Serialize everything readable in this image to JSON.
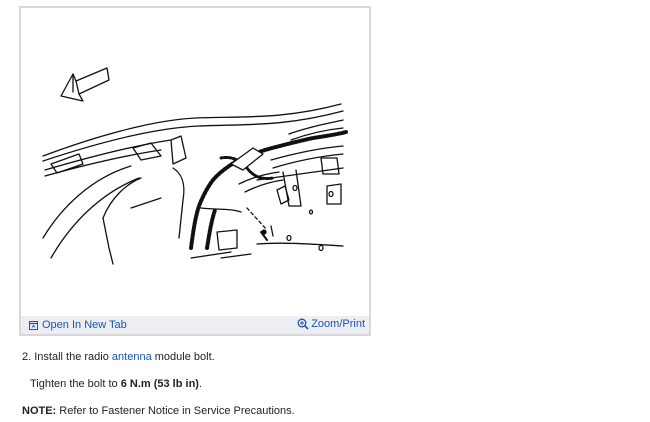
{
  "figure": {
    "open_tab_label": "Open In New Tab",
    "zoom_print_label": "Zoom/Print"
  },
  "step": {
    "number": "2.",
    "text_before": "Install the radio",
    "link_text": "antenna",
    "text_after": "module bolt."
  },
  "torque": {
    "text_before": "Tighten the bolt to",
    "value": "6 N.m (53 lb in)",
    "text_after": "."
  },
  "note": {
    "label": "NOTE:",
    "text": "Refer to Fastener Notice in Service Precautions."
  },
  "colors": {
    "link": "#1a56a8",
    "footer_bg": "#eceef3",
    "border": "#d8d8d8"
  }
}
